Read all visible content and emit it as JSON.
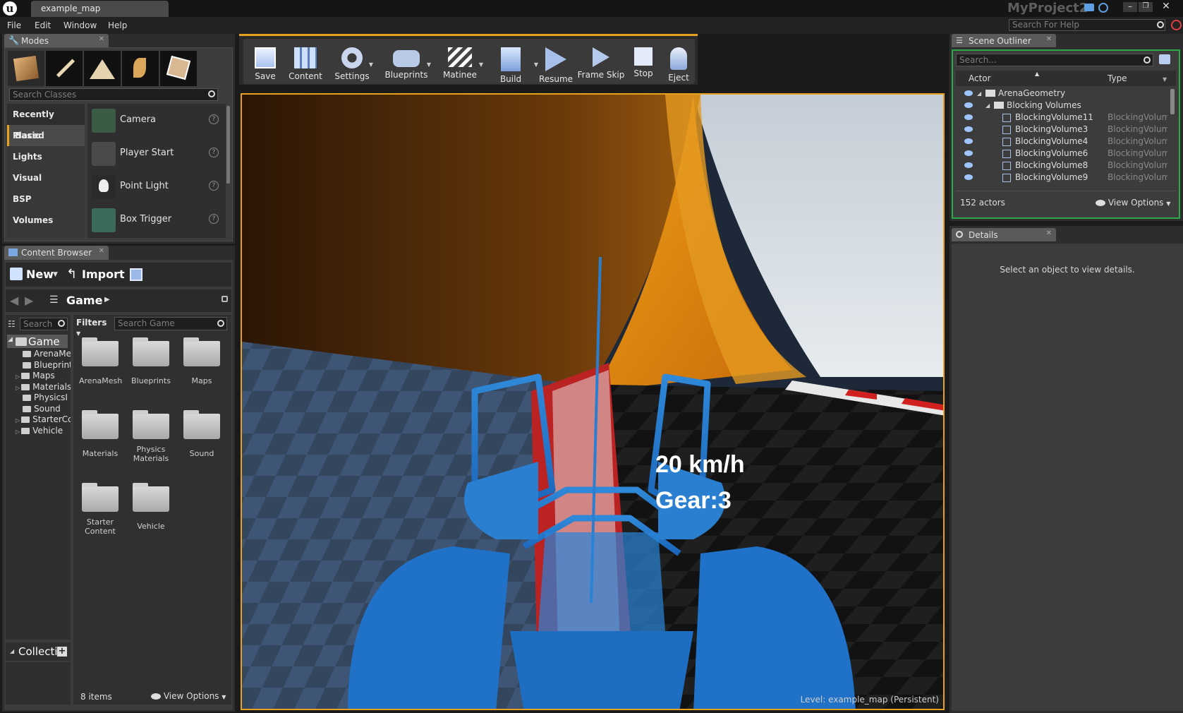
{
  "window": {
    "tab_title": "example_map",
    "project_name": "MyProject2",
    "help_search_placeholder": "Search For Help"
  },
  "menu": [
    "File",
    "Edit",
    "Window",
    "Help"
  ],
  "modes": {
    "tab_label": "Modes",
    "search_placeholder": "Search Classes",
    "categories": [
      "Recently Placed",
      "Basic",
      "Lights",
      "Visual",
      "BSP",
      "Volumes"
    ],
    "items": [
      "Camera",
      "Player Start",
      "Point Light",
      "Box Trigger"
    ]
  },
  "content_browser": {
    "tab_label": "Content Browser",
    "new_label": "New",
    "import_label": "Import",
    "path_label": "Game",
    "tree_search_placeholder": "Search",
    "filters_label": "Filters",
    "asset_search_placeholder": "Search Game",
    "tree": [
      "Game",
      "ArenaMe",
      "Blueprint",
      "Maps",
      "Materials",
      "PhysicsI",
      "Sound",
      "StarterCo",
      "Vehicle"
    ],
    "folders": [
      "ArenaMesh",
      "Blueprints",
      "Maps",
      "Materials",
      "Physics Materials",
      "Sound",
      "Starter Content",
      "Vehicle"
    ],
    "collections_label": "Collecti",
    "item_count": "8 items",
    "view_options": "View Options"
  },
  "toolbar": [
    "Save",
    "Content",
    "Settings",
    "Blueprints",
    "Matinee",
    "Build",
    "Resume",
    "Frame Skip",
    "Stop",
    "Eject"
  ],
  "viewport": {
    "speed": "20 km/h",
    "gear": "Gear:3",
    "level_label": "Level:",
    "level_name": "example_map (Persistent)"
  },
  "outliner": {
    "tab_label": "Scene Outliner",
    "search_placeholder": "Search...",
    "col_actor": "Actor",
    "col_type": "Type",
    "rows": [
      {
        "name": "ArenaGeometry",
        "type": ""
      },
      {
        "name": "Blocking Volumes",
        "type": ""
      },
      {
        "name": "BlockingVolume11",
        "type": "BlockingVolum"
      },
      {
        "name": "BlockingVolume3",
        "type": "BlockingVolum"
      },
      {
        "name": "BlockingVolume4",
        "type": "BlockingVolum"
      },
      {
        "name": "BlockingVolume6",
        "type": "BlockingVolum"
      },
      {
        "name": "BlockingVolume8",
        "type": "BlockingVolum"
      },
      {
        "name": "BlockingVolume9",
        "type": "BlockingVolum"
      }
    ],
    "actor_count": "152 actors",
    "view_options": "View Options"
  },
  "details": {
    "tab_label": "Details",
    "empty_message": "Select an object to view details."
  }
}
